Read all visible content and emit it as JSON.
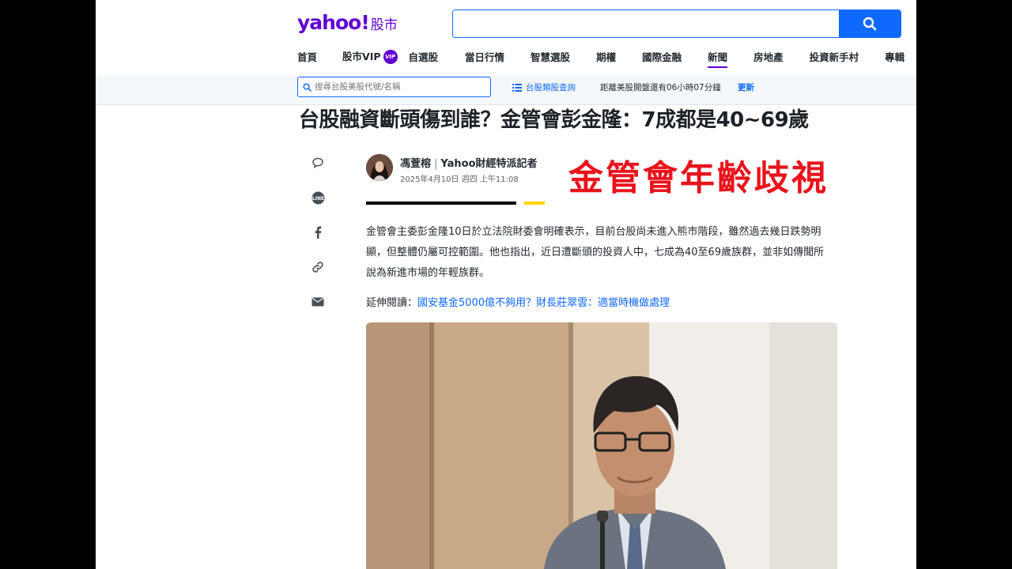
{
  "header": {
    "logo_text": "yahoo!",
    "logo_section": "股市",
    "search": {
      "value": "",
      "placeholder": ""
    },
    "nav_items": [
      {
        "label": "首頁"
      },
      {
        "label": "股市VIP",
        "badge": "VIP"
      },
      {
        "label": "自選股"
      },
      {
        "label": "當日行情"
      },
      {
        "label": "智慧選股"
      },
      {
        "label": "期權"
      },
      {
        "label": "國際金融"
      },
      {
        "label": "新聞",
        "active": true
      },
      {
        "label": "房地產"
      },
      {
        "label": "投資新手村"
      },
      {
        "label": "專輯"
      }
    ]
  },
  "subbar": {
    "quote_search_placeholder": "搜尋台股美股代號/名稱",
    "category_link": "台股類股查詢",
    "countdown": "距離美股開盤還有06小時07分鐘",
    "refresh": "更新"
  },
  "article": {
    "headline": "台股融資斷頭傷到誰？金管會彭金隆：7成都是40~69歲",
    "author": "馮萱榕",
    "author_title": "Yahoo財經特派記者",
    "date": "2025年4月10日 週四 上午11:08",
    "overlay_caption": "金管會年齡歧視",
    "body": "金管會主委彭金隆10日於立法院財委會明確表示，目前台股尚未進入熊市階段，雖然過去幾日跌勢明顯，但整體仍屬可控範圍。他也指出，近日遭斷頭的投資人中，七成為40至69歲族群，並非如傳聞所說為新進市場的年輕族群。",
    "related_label": "延伸閱讀：",
    "related_link": "國安基金5000億不夠用？財長莊翠雲：適當時機做處理"
  },
  "share_icons": [
    "comment-icon",
    "line-icon",
    "facebook-icon",
    "link-icon",
    "mail-icon"
  ],
  "colors": {
    "brand_purple": "#6001d2",
    "accent_blue": "#0f69ff",
    "overlay_red": "#e8141c"
  }
}
